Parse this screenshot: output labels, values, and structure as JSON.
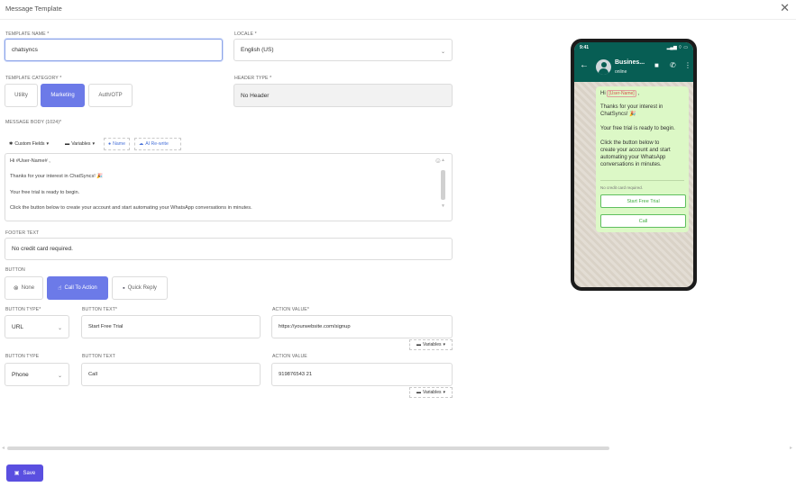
{
  "header": {
    "title": "Message Template",
    "close": "✕"
  },
  "template_name": {
    "label": "TEMPLATE NAME *",
    "value": "chatsyncs"
  },
  "locale": {
    "label": "LOCALE *",
    "value": "English (US)"
  },
  "category": {
    "label": "TEMPLATE CATEGORY *",
    "options": [
      "Utility",
      "Marketing",
      "Auth/OTP"
    ],
    "selected": "Marketing"
  },
  "header_type": {
    "label": "HEADER TYPE *",
    "value": "No Header"
  },
  "body": {
    "label": "MESSAGE BODY (1024)*",
    "toolbar": {
      "custom_fields": "Custom Fields",
      "variables": "Variables",
      "name": "Name",
      "ai_rewrite": "AI Re-write"
    },
    "line1_prefix": "Hi",
    "line1_tag": "#User-Name#",
    "line1_suffix": ",",
    "line2": "Thanks for your interest in ChatSyncs! 🎉",
    "line3": "Your free trial is ready to begin.",
    "line4": "Click the button below to create your account and start automating your WhatsApp conversations in minutes."
  },
  "footer": {
    "label": "FOOTER TEXT",
    "value": "No credit card required."
  },
  "button": {
    "label": "BUTTON",
    "options": [
      "None",
      "Call To Action",
      "Quick Reply"
    ],
    "selected": "Call To Action"
  },
  "cta1": {
    "type_label": "BUTTON TYPE*",
    "type_value": "URL",
    "text_label": "BUTTON TEXT*",
    "text_value": "Start Free Trial",
    "value_label": "ACTION VALUE*",
    "value_value": "https://yourwebsite.com/signup",
    "variables": "Variables"
  },
  "cta2": {
    "type_label": "BUTTON TYPE",
    "type_value": "Phone",
    "text_label": "BUTTON TEXT",
    "text_value": "Call",
    "value_label": "ACTION VALUE",
    "value_value": "919876543 21",
    "variables": "Variables"
  },
  "save": {
    "label": "Save"
  },
  "preview": {
    "time": "9:41",
    "status_icons": "▂▄▆ ⌔ ▭",
    "business_name": "Busines...",
    "online": "online",
    "greeting": "Hi",
    "tag": "[User-Name]",
    "greeting_suffix": ",",
    "line_thanks_1": "Thanks for your interest in",
    "line_thanks_2": "ChatSyncs! 🎉",
    "line_trial": "Your free trial is ready to begin.",
    "line_click_1": "Click the button below to",
    "line_click_2": "create your account and start",
    "line_click_3": "automating your WhatsApp",
    "line_click_4": "conversations in minutes.",
    "footer": "No credit card required.",
    "btn1": "Start Free Trial",
    "btn2": "Call"
  }
}
